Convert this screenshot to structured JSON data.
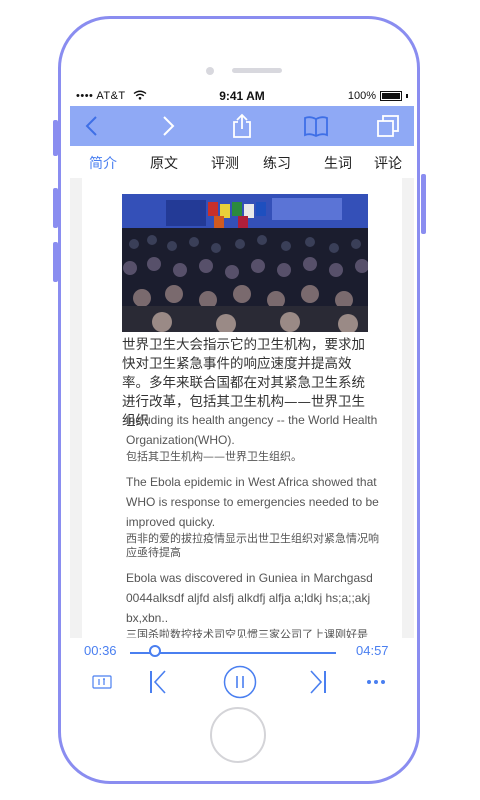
{
  "status_bar": {
    "carrier": "•••• AT&T",
    "time": "9:41 AM",
    "battery": "100%"
  },
  "toolbar": {
    "icons": [
      "back-icon",
      "forward-icon",
      "share-icon",
      "book-icon",
      "copy-icon"
    ]
  },
  "tabs": [
    {
      "label": "简介",
      "active": true
    },
    {
      "label": "原文",
      "active": false
    },
    {
      "label": "评测",
      "active": false
    },
    {
      "label": "练习",
      "active": false
    },
    {
      "label": "生词",
      "active": false
    },
    {
      "label": "评论",
      "active": false
    }
  ],
  "article": {
    "headline": "世界卫生大会指示它的卫生机构，要求加快对卫生紧急事件的响应速度并提高效率。多年来联合国都在对其紧急卫生系统进行改革，包括其卫生机构——世界卫生组织",
    "paragraphs": [
      {
        "en": "including its health angency -- the World Health  Organization(WHO).",
        "zh": "包括其卫生机构——世界卫生组织。"
      },
      {
        "en": "The Ebola epidemic in West Africa showed that WHO is response to emergencies needed to be improved quicky.",
        "zh": "西非的爱的拔拉疫情显示出世卫生组织对紧急情况响应亟待提高"
      },
      {
        "en": "Ebola was discovered in Guniea in Marchgasd 0044alksdf aljfd alsfj alkdfj alfja a;ldkj hs;a;;akj bx,xbn..",
        "zh": "三国杀啦数控技术司空见惯三家公司了上课刚好是"
      }
    ]
  },
  "player": {
    "current_time": "00:36",
    "total_time": "04:57",
    "progress": 0.12
  },
  "colors": {
    "toolbar": "#8fa9f5",
    "accent": "#4a7ff0",
    "frame": "#8a8df0"
  }
}
